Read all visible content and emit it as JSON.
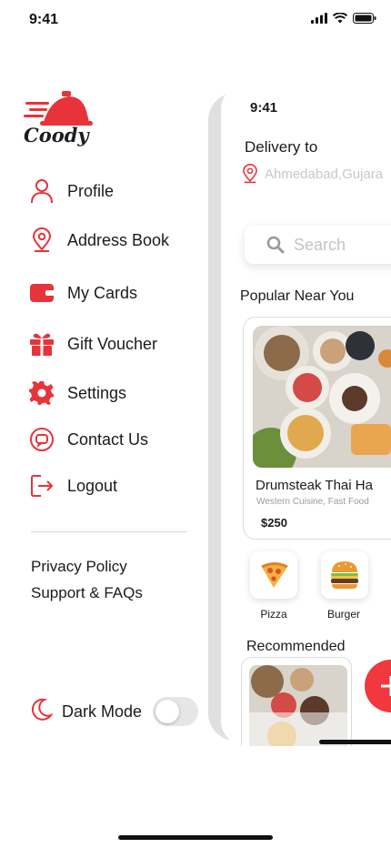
{
  "status_bar": {
    "time": "9:41"
  },
  "brand": {
    "name": "Coody",
    "accent": "#e8333a"
  },
  "menu": [
    {
      "label": "Profile",
      "icon": "user-icon"
    },
    {
      "label": "Address Book",
      "icon": "map-pin-icon"
    },
    {
      "label": "My Cards",
      "icon": "wallet-icon"
    },
    {
      "label": "Gift Voucher",
      "icon": "gift-icon"
    },
    {
      "label": "Settings",
      "icon": "gear-icon"
    },
    {
      "label": "Contact Us",
      "icon": "chat-icon"
    },
    {
      "label": "Logout",
      "icon": "logout-icon"
    }
  ],
  "links": {
    "privacy": "Privacy Policy",
    "support": "Support & FAQs"
  },
  "dark_mode": {
    "label": "Dark Mode",
    "enabled": false
  },
  "preview": {
    "time": "9:41",
    "delivery_to": "Delivery to",
    "location": "Ahmedabad,Gujara",
    "search_placeholder": "Search",
    "popular_title": "Popular Near You",
    "card": {
      "title": "Drumsteak Thai Ha",
      "subtitle": "Western Cuisine, Fast Food",
      "price": "$250"
    },
    "categories": [
      {
        "label": "Pizza",
        "icon": "pizza-icon"
      },
      {
        "label": "Burger",
        "icon": "burger-icon"
      }
    ],
    "recommended_title": "Recommended"
  }
}
